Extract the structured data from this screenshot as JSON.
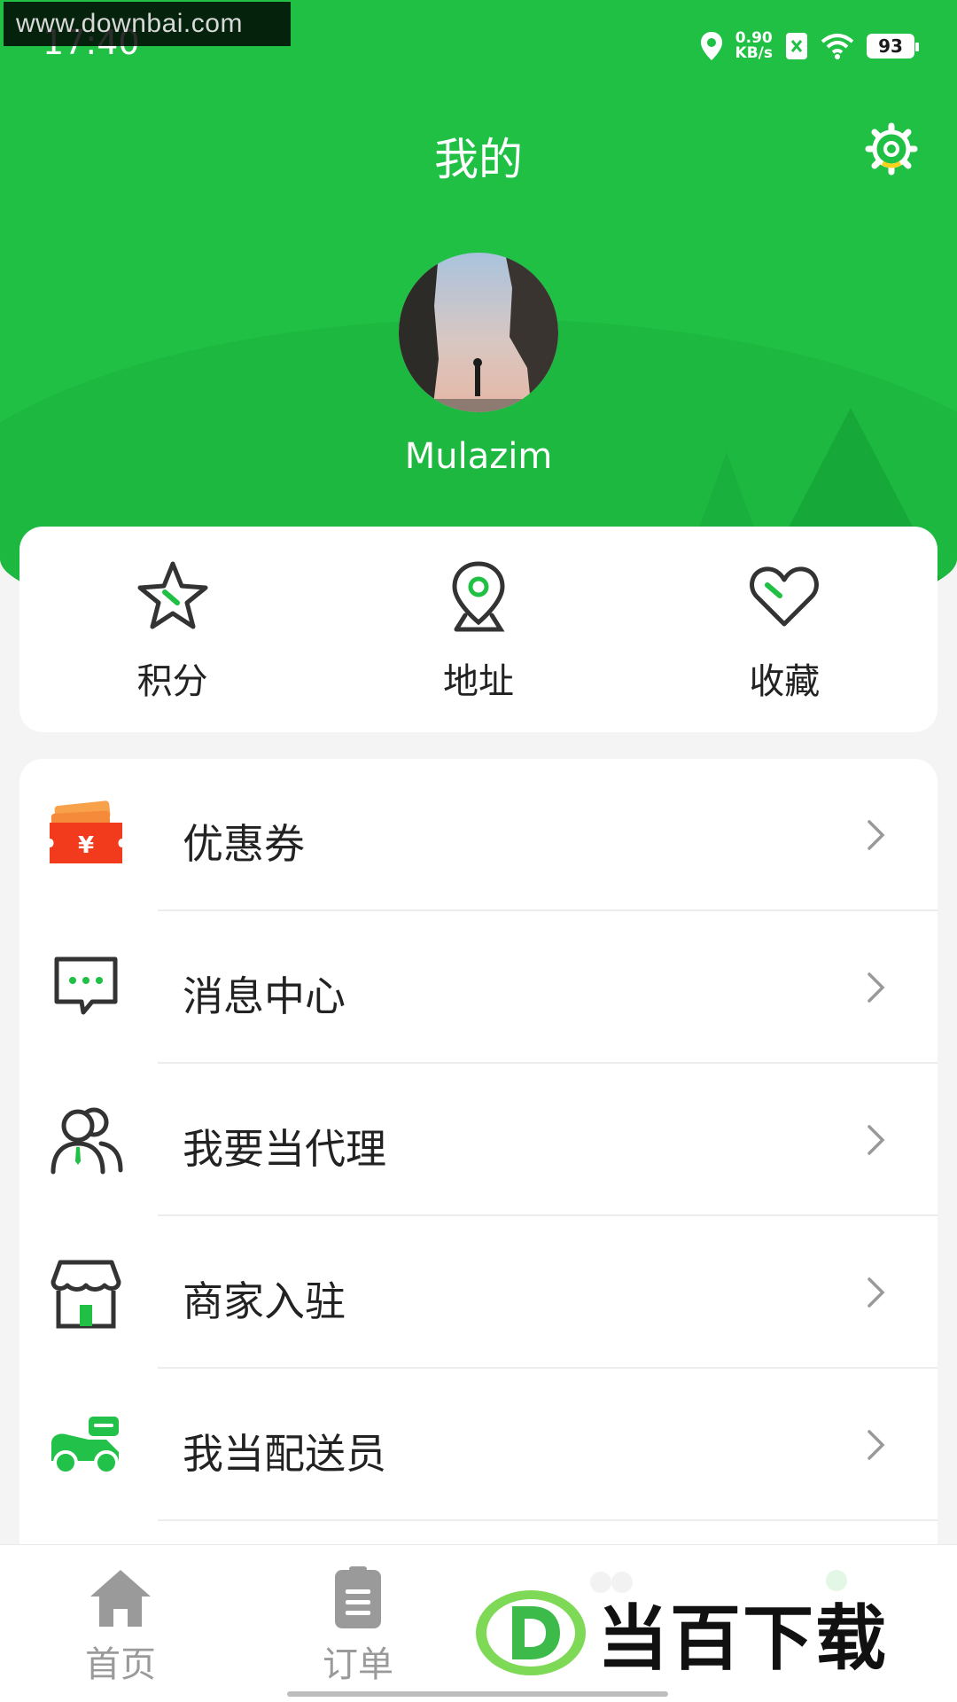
{
  "status_bar": {
    "time": "17:40",
    "watermark": "www.downbai.com",
    "net_speed_value": "0.90",
    "net_speed_unit": "KB/s",
    "battery": "93"
  },
  "header": {
    "title": "我的",
    "username": "Mulazim"
  },
  "quick_actions": [
    {
      "label": "积分",
      "icon": "star-icon"
    },
    {
      "label": "地址",
      "icon": "location-pin-icon"
    },
    {
      "label": "收藏",
      "icon": "heart-icon"
    }
  ],
  "menu": [
    {
      "label": "优惠券",
      "icon": "coupon-icon"
    },
    {
      "label": "消息中心",
      "icon": "message-icon"
    },
    {
      "label": "我要当代理",
      "icon": "agent-icon"
    },
    {
      "label": "商家入驻",
      "icon": "store-icon"
    },
    {
      "label": "我当配送员",
      "icon": "courier-icon"
    }
  ],
  "bottom_nav": [
    {
      "label": "首页",
      "icon": "home-icon"
    },
    {
      "label": "订单",
      "icon": "order-icon"
    },
    {
      "label": "",
      "icon": "faded-icon"
    },
    {
      "label": "",
      "icon": "faded-icon"
    }
  ],
  "overlay_logo_text": "当百下载",
  "colors": {
    "brand_green": "#1fc043",
    "coupon_red": "#f23a1d",
    "courier_green": "#22c24a"
  }
}
